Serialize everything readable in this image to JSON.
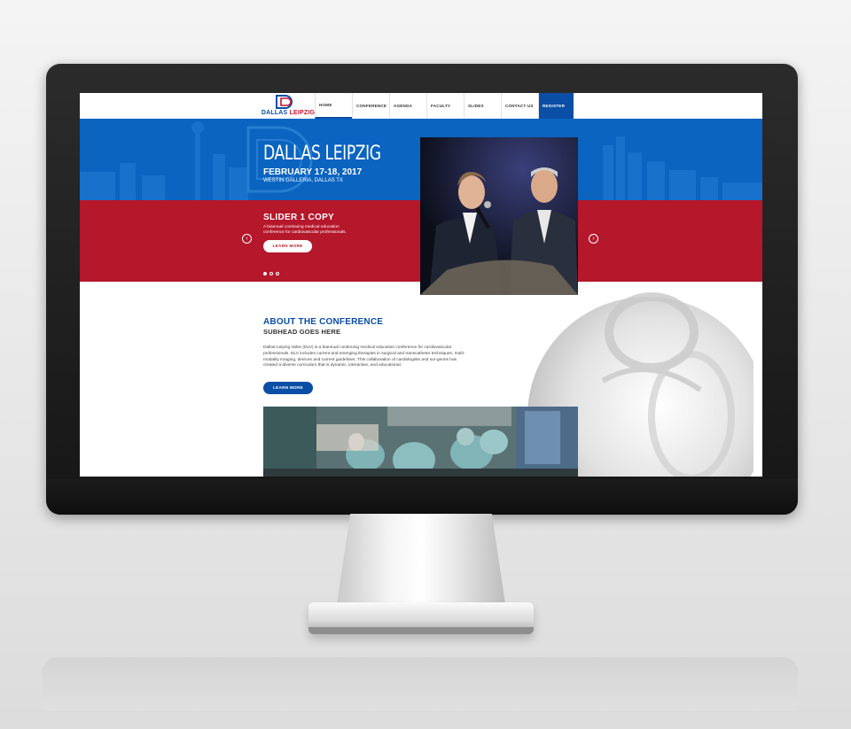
{
  "colors": {
    "brand_blue": "#0a64c0",
    "brand_red": "#b5172b",
    "nav_blue": "#0a4ea6"
  },
  "logo": {
    "part1": "DALLAS",
    "part2": "LEIPZIG"
  },
  "nav": {
    "items": [
      {
        "label": "HOME",
        "active": true
      },
      {
        "label": "CONFERENCE"
      },
      {
        "label": "AGENDA"
      },
      {
        "label": "FACULTY"
      },
      {
        "label": "SLIDES"
      },
      {
        "label": "CONTACT US"
      }
    ],
    "register": "REGISTER"
  },
  "hero": {
    "title": "DALLAS LEIPZIG",
    "date": "FEBRUARY 17-18, 2017",
    "venue": "WESTIN GALLERIA, DALLAS TX"
  },
  "slide": {
    "title": "SLIDER 1 COPY",
    "description": "A biannual continuing medical education conference for cardiovascular professionals.",
    "cta": "LEARN MORE",
    "dots": 3,
    "active_dot": 1
  },
  "about": {
    "title": "ABOUT THE CONFERENCE",
    "subhead": "SUBHEAD GOES HERE",
    "body": "Dallas-Leipzig Valve (DLV) is a biannual continuing medical education conference for cardiovascular professionals. DLV includes current and emerging therapies in surgical and transcatheter techniques, multi-modality imaging, devices and current guidelines. This collaboration of cardiologists and sur-geons has created a diverse curriculum that is dynamic, interactive, and educational.",
    "cta": "LEARN MORE"
  },
  "icons": {
    "prev": "chevron-left-icon",
    "next": "chevron-right-icon"
  }
}
